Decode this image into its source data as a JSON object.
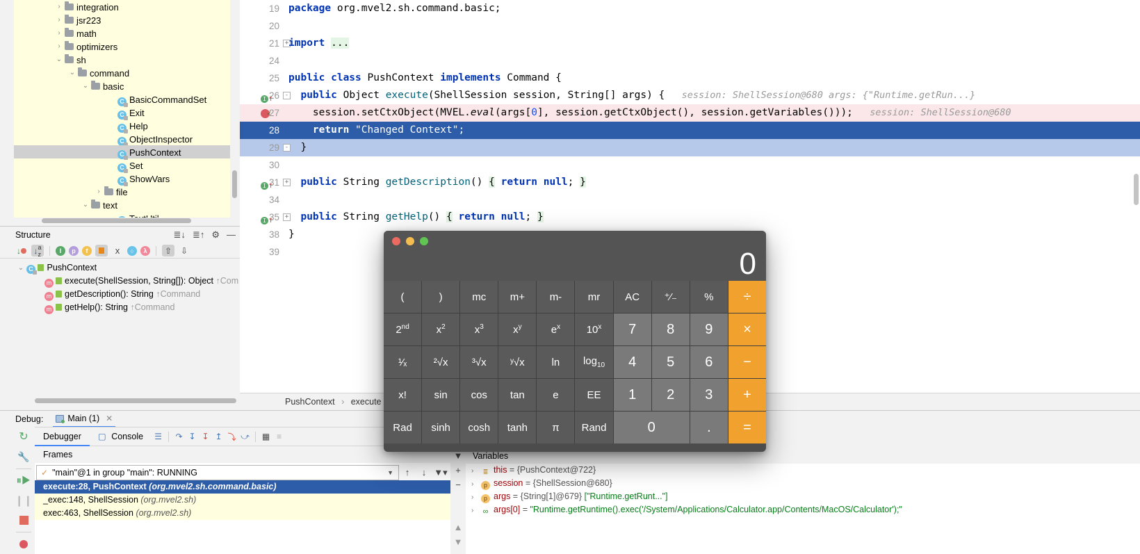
{
  "project": {
    "items": [
      {
        "indent": 3,
        "arrow": "›",
        "type": "folder",
        "label": "integration"
      },
      {
        "indent": 3,
        "arrow": "›",
        "type": "folder",
        "label": "jsr223"
      },
      {
        "indent": 3,
        "arrow": "›",
        "type": "folder",
        "label": "math"
      },
      {
        "indent": 3,
        "arrow": "›",
        "type": "folder",
        "label": "optimizers"
      },
      {
        "indent": 3,
        "arrow": "⌄",
        "type": "folder",
        "label": "sh"
      },
      {
        "indent": 4,
        "arrow": "⌄",
        "type": "folder",
        "label": "command"
      },
      {
        "indent": 5,
        "arrow": "⌄",
        "type": "folder",
        "label": "basic"
      },
      {
        "indent": 7,
        "arrow": "",
        "type": "class",
        "label": "BasicCommandSet"
      },
      {
        "indent": 7,
        "arrow": "",
        "type": "class",
        "label": "Exit"
      },
      {
        "indent": 7,
        "arrow": "",
        "type": "class",
        "label": "Help"
      },
      {
        "indent": 7,
        "arrow": "",
        "type": "class",
        "label": "ObjectInspector"
      },
      {
        "indent": 7,
        "arrow": "",
        "type": "class",
        "label": "PushContext",
        "selected": true
      },
      {
        "indent": 7,
        "arrow": "",
        "type": "class",
        "label": "Set"
      },
      {
        "indent": 7,
        "arrow": "",
        "type": "class",
        "label": "ShowVars"
      },
      {
        "indent": 6,
        "arrow": "›",
        "type": "folder",
        "label": "file"
      },
      {
        "indent": 5,
        "arrow": "⌄",
        "type": "folder",
        "label": "text"
      },
      {
        "indent": 7,
        "arrow": "",
        "type": "class",
        "label": "TextUtil"
      }
    ]
  },
  "structure": {
    "title": "Structure",
    "toolbar_icons": [
      "sort-by-visibility-icon",
      "sort-alphabetically-icon",
      "show-inherited-icon",
      "show-properties-icon",
      "show-fields-icon",
      "show-non-public-icon",
      "group-methods-icon",
      "show-anonymous-icon",
      "show-lambdas-icon",
      "expand-all-icon",
      "collapse-all-icon"
    ],
    "header_icons": [
      "expand-all-icon",
      "collapse-all-icon",
      "gear-icon",
      "hide-icon"
    ],
    "items": [
      {
        "indent": 0,
        "arrow": "⌄",
        "kind": "class",
        "label": "PushContext",
        "inherited": ""
      },
      {
        "indent": 1,
        "arrow": "",
        "kind": "method",
        "label": "execute(ShellSession, String[]): Object",
        "inherited": "↑Com"
      },
      {
        "indent": 1,
        "arrow": "",
        "kind": "method",
        "label": "getDescription(): String",
        "inherited": "↑Command"
      },
      {
        "indent": 1,
        "arrow": "",
        "kind": "method",
        "label": "getHelp(): String",
        "inherited": "↑Command"
      }
    ]
  },
  "editor": {
    "lines": [
      {
        "num": "19",
        "code_html": "<span class=\"kw\">package</span> org.mvel2.sh.command.basic;"
      },
      {
        "num": "20",
        "code_html": ""
      },
      {
        "num": "21",
        "code_html": "<span class=\"kw\">import</span> <span class=\"hl-green\">...</span>",
        "fold": "+"
      },
      {
        "num": "24",
        "code_html": ""
      },
      {
        "num": "25",
        "code_html": "<span class=\"kw\">public class</span> PushContext <span class=\"kw\">implements</span> Command {"
      },
      {
        "num": "26",
        "code_html": "&nbsp;&nbsp;<span class=\"kw\">public</span> Object <span class=\"mth\">execute</span>(ShellSession session, String[] args) {",
        "marker": "impl",
        "fold": "-",
        "hint": "session: ShellSession@680     args: {\"Runtime.getRun...}"
      },
      {
        "num": "27",
        "code_html": "&nbsp;&nbsp;&nbsp;&nbsp;session.setCtxObject(MVEL.<i>eval</i>(args[<span class=\"num\">0</span>], session.getCtxObject(), session.getVariables()));",
        "marker": "breakpoint",
        "state": "bp",
        "hint": "session: ShellSession@680"
      },
      {
        "num": "28",
        "code_html": "&nbsp;&nbsp;&nbsp;&nbsp;<span class=\"kw\">return</span> <span class=\"str\">\"Changed Context\"</span>;",
        "state": "exec"
      },
      {
        "num": "29",
        "code_html": "&nbsp;&nbsp;}",
        "state": "sel2",
        "fold": "-"
      },
      {
        "num": "30",
        "code_html": ""
      },
      {
        "num": "31",
        "code_html": "&nbsp;&nbsp;<span class=\"kw\">public</span> String <span class=\"mth\">getDescription</span>() <span class=\"hl-green\">{</span> <span class=\"kw\">return</span> <span class=\"kw\">null</span>; <span class=\"hl-green\">}</span>",
        "marker": "impl",
        "fold": "+"
      },
      {
        "num": "34",
        "code_html": ""
      },
      {
        "num": "35",
        "code_html": "&nbsp;&nbsp;<span class=\"kw\">public</span> String <span class=\"mth\">getHelp</span>() <span class=\"hl-green\">{</span> <span class=\"kw\">return</span> <span class=\"kw\">null</span>; <span class=\"hl-green\">}</span>",
        "marker": "impl",
        "fold": "+"
      },
      {
        "num": "38",
        "code_html": "}"
      },
      {
        "num": "39",
        "code_html": ""
      }
    ]
  },
  "breadcrumb": {
    "parts": [
      "PushContext",
      "execute"
    ]
  },
  "debug": {
    "label": "Debug:",
    "tab_title": "Main (1)",
    "tabs": [
      {
        "label": "Debugger",
        "active": true,
        "icon": ""
      },
      {
        "label": "Console",
        "active": false,
        "icon": "console-icon"
      }
    ],
    "toolbar_icons": [
      "layout-icon",
      "step-over-icon",
      "step-into-icon",
      "force-step-into-icon",
      "step-out-icon",
      "drop-frame-icon",
      "run-to-cursor-icon",
      "evaluate-icon",
      "mute-breakpoints-icon"
    ],
    "rail_icons": [
      "rerun-icon",
      "settings-icon",
      "resume-icon",
      "pause-icon",
      "stop-icon",
      "breakpoints-icon"
    ],
    "frames_label": "Frames",
    "thread": "\"main\"@1 in group \"main\": RUNNING",
    "frames": [
      {
        "text": "execute:28, PushContext",
        "pkg": "(org.mvel2.sh.command.basic)",
        "selected": true
      },
      {
        "text": "_exec:148, ShellSession",
        "pkg": "(org.mvel2.sh)",
        "selected": false
      },
      {
        "text": "exec:463, ShellSession",
        "pkg": "(org.mvel2.sh)",
        "selected": false
      }
    ]
  },
  "variables": {
    "label": "Variables",
    "rail_icons": [
      "filter-icon",
      "add-icon",
      "remove-icon",
      "scroll-up-icon",
      "scroll-down-icon"
    ],
    "rows": [
      {
        "icon": "this",
        "name": "this",
        "eq": " = ",
        "value": "{PushContext@722}",
        "value_str": ""
      },
      {
        "icon": "p",
        "name": "session",
        "eq": " = ",
        "value": "{ShellSession@680}",
        "value_str": ""
      },
      {
        "icon": "p",
        "name": "args",
        "eq": " = ",
        "value": "{String[1]@679} ",
        "value_str": "[\"Runtime.getRunt...\"]"
      },
      {
        "icon": "arr",
        "name": "args[0]",
        "eq": " = ",
        "value": "",
        "value_str": "\"Runtime.getRuntime().exec('/System/Applications/Calculator.app/Contents/MacOS/Calculator');\""
      }
    ]
  },
  "calculator": {
    "display": "0",
    "traffic_lights": [
      "#ec6a5f",
      "#f4bd4f",
      "#61c554"
    ],
    "colors": {
      "operator": "#f0a12e",
      "number": "#7a7a7a",
      "function": "#5a5a5a"
    },
    "keys": [
      {
        "label": "(",
        "kind": "fn"
      },
      {
        "label": ")",
        "kind": "fn"
      },
      {
        "label": "mc",
        "kind": "fn"
      },
      {
        "label": "m+",
        "kind": "fn"
      },
      {
        "label": "m-",
        "kind": "fn"
      },
      {
        "label": "mr",
        "kind": "fn"
      },
      {
        "label": "AC",
        "kind": "fn"
      },
      {
        "label": "⁺⁄₋",
        "kind": "fn"
      },
      {
        "label": "%",
        "kind": "fn"
      },
      {
        "label": "÷",
        "kind": "op"
      },
      {
        "label": "2nd",
        "kind": "fn",
        "sup": "nd",
        "base": "2"
      },
      {
        "label": "x²",
        "kind": "fn",
        "sup": "2",
        "base": "x"
      },
      {
        "label": "x³",
        "kind": "fn",
        "sup": "3",
        "base": "x"
      },
      {
        "label": "xʸ",
        "kind": "fn",
        "sup": "y",
        "base": "x"
      },
      {
        "label": "eˣ",
        "kind": "fn",
        "sup": "x",
        "base": "e"
      },
      {
        "label": "10ˣ",
        "kind": "fn",
        "sup": "x",
        "base": "10"
      },
      {
        "label": "7",
        "kind": "num"
      },
      {
        "label": "8",
        "kind": "num"
      },
      {
        "label": "9",
        "kind": "num"
      },
      {
        "label": "×",
        "kind": "op"
      },
      {
        "label": "¹⁄ₓ",
        "kind": "fn"
      },
      {
        "label": "²√x",
        "kind": "fn"
      },
      {
        "label": "³√x",
        "kind": "fn"
      },
      {
        "label": "ʸ√x",
        "kind": "fn"
      },
      {
        "label": "ln",
        "kind": "fn"
      },
      {
        "label": "log₁₀",
        "kind": "fn",
        "sub": "10",
        "base": "log"
      },
      {
        "label": "4",
        "kind": "num"
      },
      {
        "label": "5",
        "kind": "num"
      },
      {
        "label": "6",
        "kind": "num"
      },
      {
        "label": "−",
        "kind": "op"
      },
      {
        "label": "x!",
        "kind": "fn"
      },
      {
        "label": "sin",
        "kind": "fn"
      },
      {
        "label": "cos",
        "kind": "fn"
      },
      {
        "label": "tan",
        "kind": "fn"
      },
      {
        "label": "e",
        "kind": "fn"
      },
      {
        "label": "EE",
        "kind": "fn"
      },
      {
        "label": "1",
        "kind": "num"
      },
      {
        "label": "2",
        "kind": "num"
      },
      {
        "label": "3",
        "kind": "num"
      },
      {
        "label": "+",
        "kind": "op"
      },
      {
        "label": "Rad",
        "kind": "fn"
      },
      {
        "label": "sinh",
        "kind": "fn"
      },
      {
        "label": "cosh",
        "kind": "fn"
      },
      {
        "label": "tanh",
        "kind": "fn"
      },
      {
        "label": "π",
        "kind": "fn"
      },
      {
        "label": "Rand",
        "kind": "fn"
      },
      {
        "label": "0",
        "kind": "num",
        "wide": true
      },
      {
        "label": ".",
        "kind": "num"
      },
      {
        "label": "=",
        "kind": "op"
      }
    ]
  }
}
